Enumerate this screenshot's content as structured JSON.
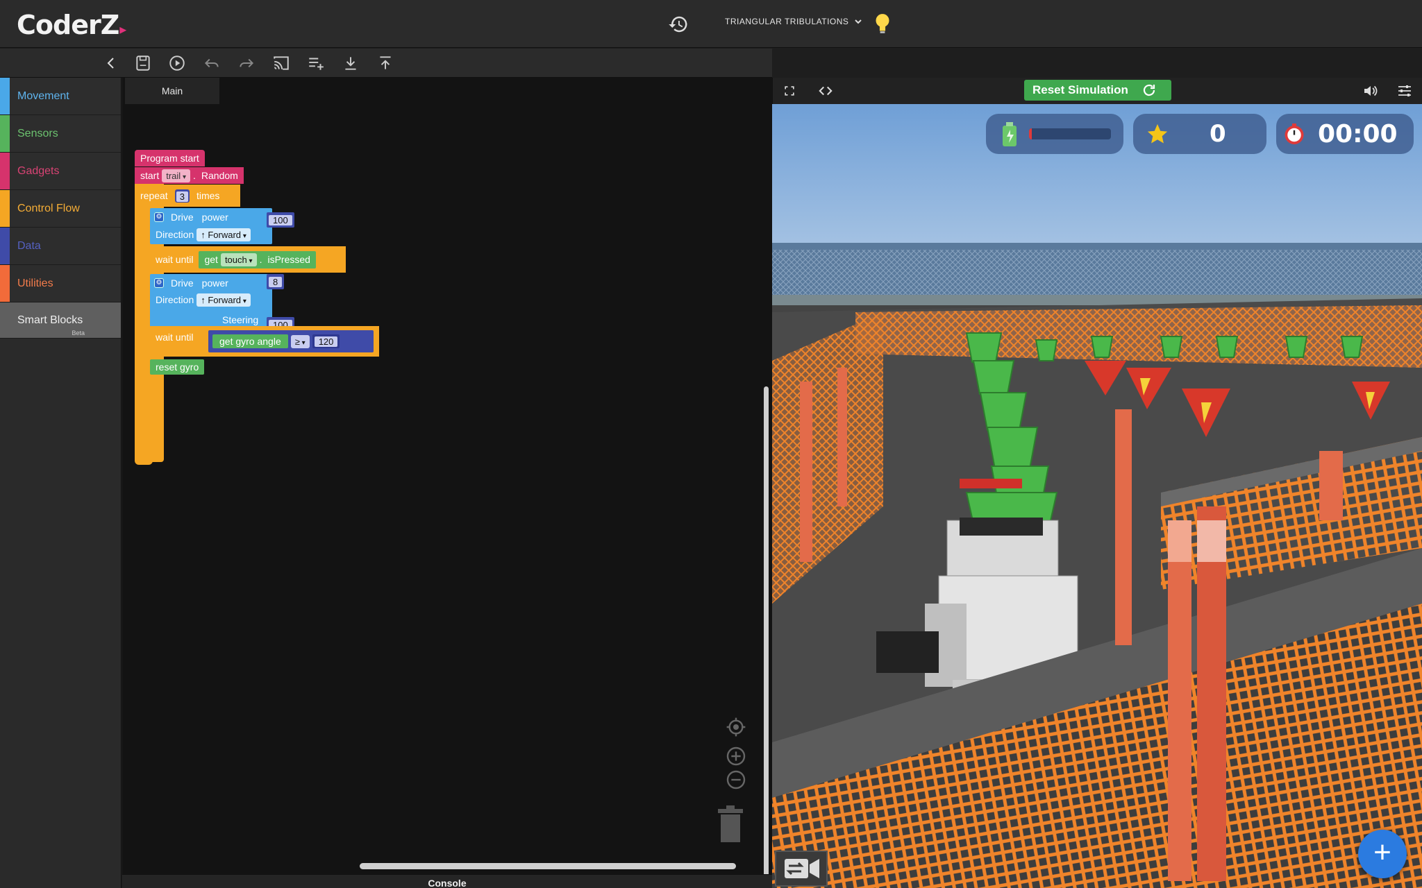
{
  "app": {
    "logo": "CoderZ"
  },
  "header": {
    "mission_title": "TRIANGULAR TRIBULATIONS"
  },
  "sidebar": {
    "items": [
      {
        "label": "Movement",
        "color": "#4aa8e8",
        "text_color": "#5fb4ee"
      },
      {
        "label": "Sensors",
        "color": "#56b35c",
        "text_color": "#6cc36f"
      },
      {
        "label": "Gadgets",
        "color": "#d6336c",
        "text_color": "#d94374"
      },
      {
        "label": "Control Flow",
        "color": "#f5a623",
        "text_color": "#f5ad36"
      },
      {
        "label": "Data",
        "color": "#3f4ba8",
        "text_color": "#5561c2"
      },
      {
        "label": "Utilities",
        "color": "#f26b3a",
        "text_color": "#f37c4b"
      }
    ],
    "smart_blocks": {
      "label": "Smart Blocks",
      "badge": "Beta"
    }
  },
  "workspace": {
    "tab_main": "Main",
    "console_label": "Console",
    "blocks": {
      "program_start": "Program start",
      "start": "start",
      "trail_option": "trail",
      "dot": ".",
      "random": "Random",
      "repeat": "repeat",
      "repeat_count": "3",
      "times": "times",
      "drive1": {
        "label": "Drive",
        "power_label": "power",
        "power": "100",
        "direction_label": "Direction",
        "direction": "↑ Forward"
      },
      "wait1": {
        "label": "wait until",
        "get": "get",
        "sensor": "touch",
        "dot": ".",
        "prop": "isPressed"
      },
      "drive2": {
        "label": "Drive",
        "power_label": "power",
        "power": "8",
        "direction_label": "Direction",
        "direction": "↑ Forward",
        "steering_label": "Steering",
        "steering": "100"
      },
      "wait2": {
        "label": "wait until",
        "get": "get gyro angle",
        "op": "≥",
        "value": "120"
      },
      "reset_gyro": "reset gyro"
    }
  },
  "simulation": {
    "reset_label": "Reset Simulation",
    "battery_level": 0.03,
    "score": "0",
    "timer": "00:00"
  }
}
